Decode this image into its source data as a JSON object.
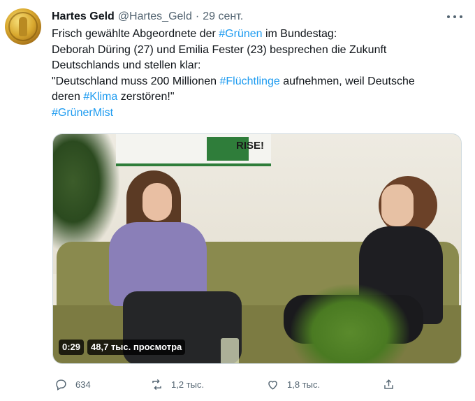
{
  "tweet": {
    "author_name": "Hartes Geld",
    "author_handle": "@Hartes_Geld",
    "separator": "·",
    "timestamp": "29 сент.",
    "text": {
      "line1_pre": "Frisch gewählte Abgeordnete der ",
      "line1_tag": "#Grünen",
      "line1_post": " im Bundestag:",
      "line2": "Deborah Düring (27) und Emilia Fester (23) besprechen die Zukunft",
      "line3": "Deutschlands und stellen klar:",
      "line4_pre": "\"Deutschland muss 200 Millionen ",
      "line4_tag": "#Flüchtlinge",
      "line4_post": " aufnehmen, weil Deutsche",
      "line5_pre": "deren ",
      "line5_tag": "#Klima",
      "line5_post": " zerstören!\"",
      "line6_tag": "#GrünerMist"
    },
    "video": {
      "duration": "0:29",
      "views": "48,7 тыс. просмотра",
      "poster_text": "RISE!"
    },
    "actions": {
      "reply_count": "634",
      "retweet_count": "1,2 тыс.",
      "like_count": "1,8 тыс."
    }
  },
  "colors": {
    "link": "#1d9bf0",
    "text": "#0f1419",
    "secondary": "#536471"
  },
  "icons": [
    "more-icon",
    "reply-icon",
    "retweet-icon",
    "like-icon",
    "share-icon"
  ]
}
